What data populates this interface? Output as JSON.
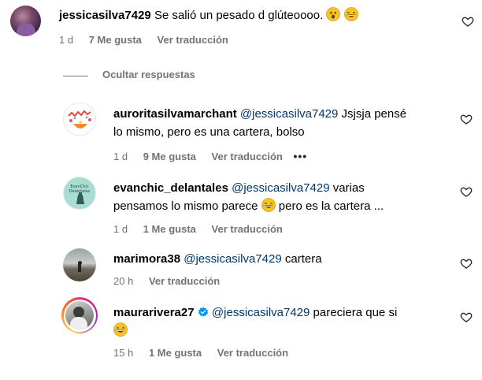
{
  "top_comment": {
    "username": "jessicasilva7429",
    "text": "Se salió un pesado d glúteoooo.",
    "time": "1 d",
    "likes": "7 Me gusta",
    "translate": "Ver traducción"
  },
  "hide_replies": "Ocultar respuestas",
  "replies": [
    {
      "username": "auroritasilvamarchant",
      "mention": "@jessicasilva7429",
      "text": "Jsjsja pensé",
      "text2": "lo mismo, pero es una cartera, bolso",
      "time": "1 d",
      "likes": "9 Me gusta",
      "translate": "Ver traducción",
      "more": "•••"
    },
    {
      "username": "evanchic_delantales",
      "mention": "@jessicasilva7429",
      "text": "varias",
      "text2a": "pensamos lo mismo parece",
      "text2b": "pero es la cartera ...",
      "avatar_text": "EvanChic Delantales",
      "time": "1 d",
      "likes": "1 Me gusta",
      "translate": "Ver traducción"
    },
    {
      "username": "marimora38",
      "mention": "@jessicasilva7429",
      "text": "cartera",
      "time": "20 h",
      "translate": "Ver traducción"
    },
    {
      "username": "maurarivera27",
      "mention": "@jessicasilva7429",
      "text": "pareciera que si",
      "time": "15 h",
      "likes": "1 Me gusta",
      "translate": "Ver traducción"
    }
  ],
  "colors": {
    "mention": "#00376b",
    "meta": "#737373",
    "verified": "#0095f6",
    "story_ring_start": "#feda75",
    "story_ring_end": "#d62976"
  },
  "icons": [
    "heart-outline-icon",
    "verified-badge-icon",
    "emoji-astonished",
    "emoji-grin-sweat"
  ]
}
